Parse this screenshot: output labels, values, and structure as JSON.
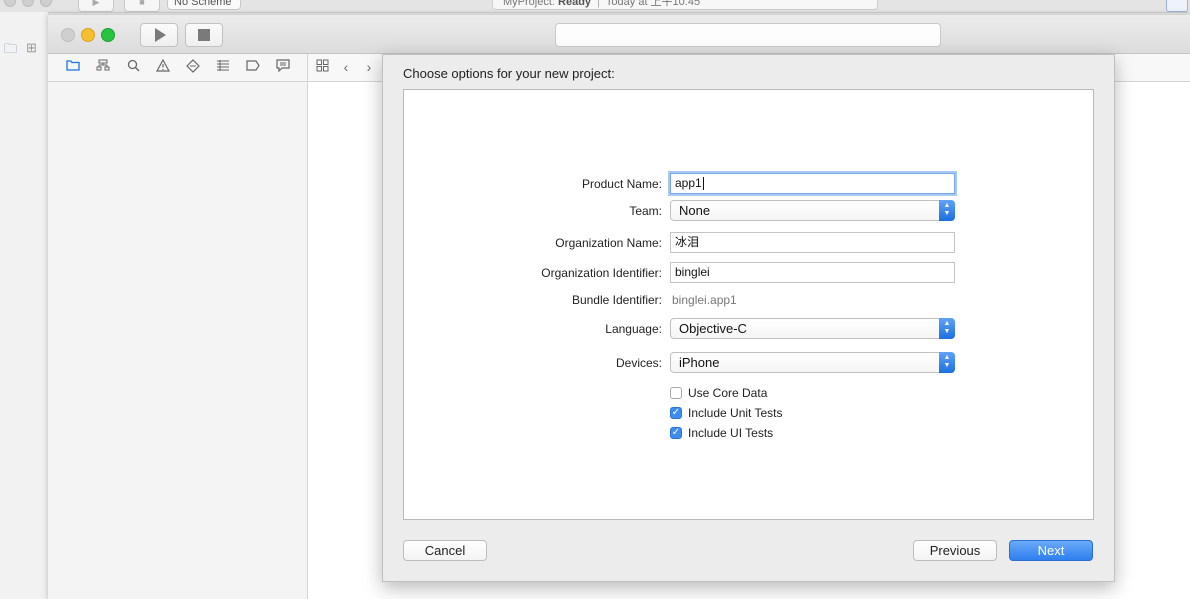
{
  "background_window": {
    "scheme": "No Scheme",
    "activity_project": "MyProject:",
    "activity_status": "Ready",
    "activity_time": "Today at 上午10:45"
  },
  "navigator_icons": [
    "folder-icon",
    "hierarchy-icon",
    "search-icon",
    "warning-icon",
    "test-icon",
    "debug-icon",
    "breakpoint-icon",
    "report-icon"
  ],
  "dialog": {
    "title": "Choose options for your new project:",
    "product_name_label": "Product Name:",
    "product_name_value": "app1",
    "team_label": "Team:",
    "team_value": "None",
    "org_name_label": "Organization Name:",
    "org_name_value": "冰泪",
    "org_id_label": "Organization Identifier:",
    "org_id_value": "binglei",
    "bundle_id_label": "Bundle Identifier:",
    "bundle_id_value": "binglei.app1",
    "language_label": "Language:",
    "language_value": "Objective-C",
    "devices_label": "Devices:",
    "devices_value": "iPhone",
    "options": [
      {
        "label": "Use Core Data",
        "checked": false
      },
      {
        "label": "Include Unit Tests",
        "checked": true
      },
      {
        "label": "Include UI Tests",
        "checked": true
      }
    ],
    "cancel_label": "Cancel",
    "previous_label": "Previous",
    "next_label": "Next",
    "accent_color": "#2e7ff0"
  }
}
